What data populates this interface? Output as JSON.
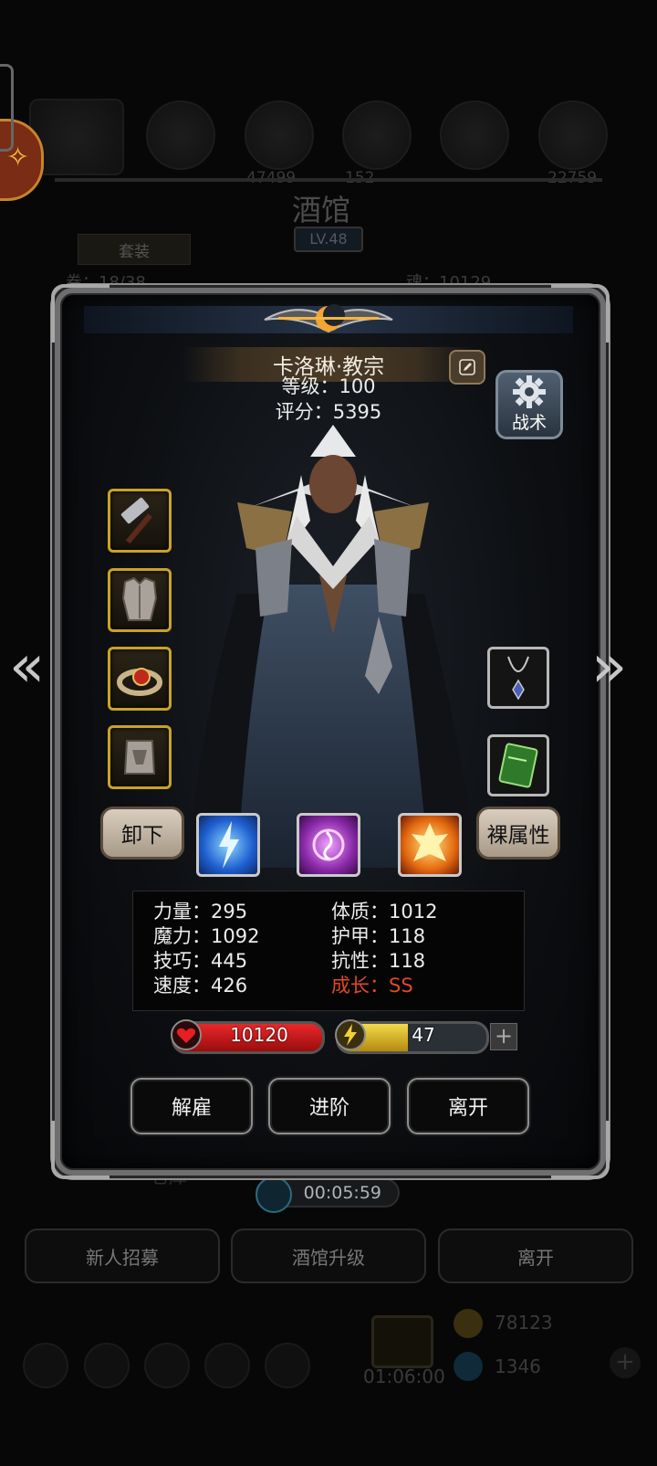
{
  "background": {
    "title": "酒馆",
    "level": "LV.48",
    "tab_outfit": "套装",
    "scroll_count": "卷：18/38",
    "soul": "魂：10129",
    "left_num": "47499",
    "mid_num": "152",
    "right_num": "22759",
    "bottom_buttons": [
      "新人招募",
      "酒馆升级",
      "离开"
    ],
    "warehouse": "仓库",
    "gold": "78123",
    "gems": "1346",
    "gift_timer": "01:06:00"
  },
  "timer": "00:05:59",
  "hero": {
    "name": "卡洛琳·教宗",
    "level": "等级：100",
    "score": "评分：5395",
    "tactic_label": "战术"
  },
  "equipment_left": [
    "hammer-icon",
    "chest-armor-icon",
    "ring-icon",
    "glove-icon"
  ],
  "equipment_right": [
    "necklace-icon",
    "scroll-book-icon"
  ],
  "buttons": {
    "unequip": "卸下",
    "bare_attributes": "裸属性",
    "dismiss": "解雇",
    "advance": "进阶",
    "leave": "离开"
  },
  "skills": [
    "lightning-skill-icon",
    "arcane-skill-icon",
    "holy-fire-skill-icon"
  ],
  "stats": {
    "strength": "力量：295",
    "magic": "魔力：1092",
    "skill": "技巧：445",
    "speed": "速度：426",
    "constitution": "体质：1012",
    "armor": "护甲：118",
    "resistance": "抗性：118",
    "growth": "成长：SS"
  },
  "bars": {
    "hp": "10120",
    "energy": "47",
    "energy_fill": 0.47
  },
  "colors": {
    "hp": "#d11a1a",
    "energy": "#e0c22c",
    "growth": "#e0482a",
    "gold_border": "#c9a227"
  }
}
